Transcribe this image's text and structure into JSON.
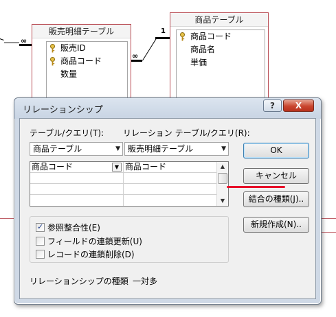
{
  "relationship_canvas": {
    "tables": [
      {
        "name": "販売明細テーブル",
        "fields": [
          {
            "label": "販売ID",
            "key": true
          },
          {
            "label": "商品コード",
            "key": true
          },
          {
            "label": "数量",
            "key": false
          }
        ]
      },
      {
        "name": "商品テーブル",
        "fields": [
          {
            "label": "商品コード",
            "key": true
          },
          {
            "label": "商品名",
            "key": false
          },
          {
            "label": "単価",
            "key": false
          }
        ]
      }
    ],
    "cardinality_one": "1"
  },
  "dialog": {
    "title": "リレーションシップ",
    "help_button": "?",
    "close_button": "X",
    "table_query_label": "テーブル/クエリ(T):",
    "related_table_query_label": "リレーション テーブル/クエリ(R):",
    "table_query_value": "商品テーブル",
    "related_table_query_value": "販売明細テーブル",
    "field_grid": [
      {
        "left": "商品コード",
        "right": "商品コード"
      },
      {
        "left": "",
        "right": ""
      },
      {
        "left": "",
        "right": ""
      },
      {
        "left": "",
        "right": ""
      }
    ],
    "options": [
      {
        "label": "参照整合性(E)",
        "checked": true
      },
      {
        "label": "フィールドの連鎖更新(U)",
        "checked": false
      },
      {
        "label": "レコードの連鎖削除(D)",
        "checked": false
      }
    ],
    "relationship_type_label": "リレーションシップの種類",
    "relationship_type_value": "一対多",
    "buttons": {
      "ok": "OK",
      "cancel": "キャンセル",
      "join_type": "結合の種類(J)..",
      "create_new": "新規作成(N).."
    },
    "highlight_color": "#e8102a"
  }
}
